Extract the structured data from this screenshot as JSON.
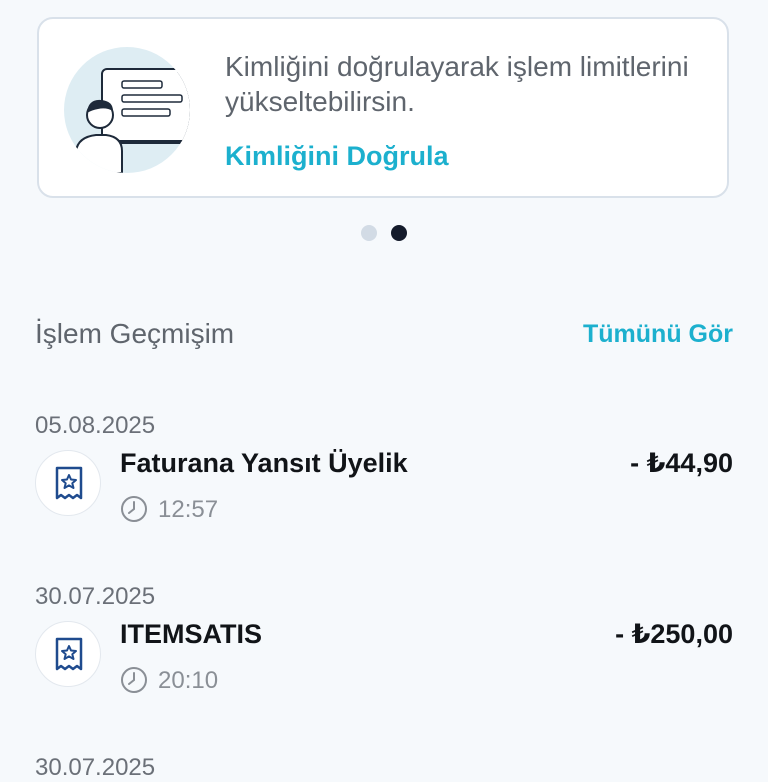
{
  "promo": {
    "text": "Kimliğini doğrulayarak işlem limitlerini yükseltebilirsin.",
    "link": "Kimliğini Doğrula",
    "illustration_icon": "id-card-illustration"
  },
  "pager": {
    "count": 2,
    "active_index": 1
  },
  "history": {
    "title": "İşlem Geçmişim",
    "see_all": "Tümünü Gör",
    "transactions": [
      {
        "date": "05.08.2025",
        "title": "Faturana Yansıt Üyelik",
        "amount": "- ₺44,90",
        "time": "12:57",
        "icon": "receipt-star-icon"
      },
      {
        "date": "30.07.2025",
        "title": "ITEMSATIS",
        "amount": "- ₺250,00",
        "time": "20:10",
        "icon": "receipt-star-icon"
      },
      {
        "date": "30.07.2025"
      }
    ]
  },
  "colors": {
    "accent": "#1cb0ce",
    "background": "#f6f9fc",
    "card_border": "#d9e1ea"
  }
}
